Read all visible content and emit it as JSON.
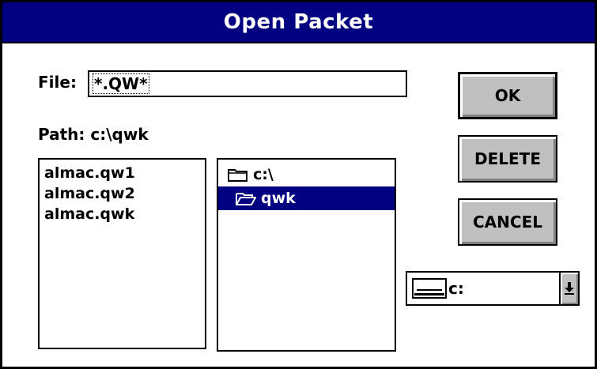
{
  "window": {
    "title": "Open Packet"
  },
  "file": {
    "label": "File:",
    "value": "*.QW*"
  },
  "path": {
    "label": "Path: c:\\qwk"
  },
  "files": [
    "almac.qw1",
    "almac.qw2",
    "almac.qwk"
  ],
  "directories": [
    {
      "name": "c:\\",
      "icon": "folder-closed-icon",
      "selected": false
    },
    {
      "name": "qwk",
      "icon": "folder-open-icon",
      "selected": true
    }
  ],
  "buttons": {
    "ok": "OK",
    "delete": "DELETE",
    "cancel": "CANCEL"
  },
  "drive": {
    "value": "c:",
    "icon": "drive-icon"
  },
  "colors": {
    "title_bar": "#000080",
    "selection": "#000080",
    "button_face": "#c0c0c0"
  }
}
